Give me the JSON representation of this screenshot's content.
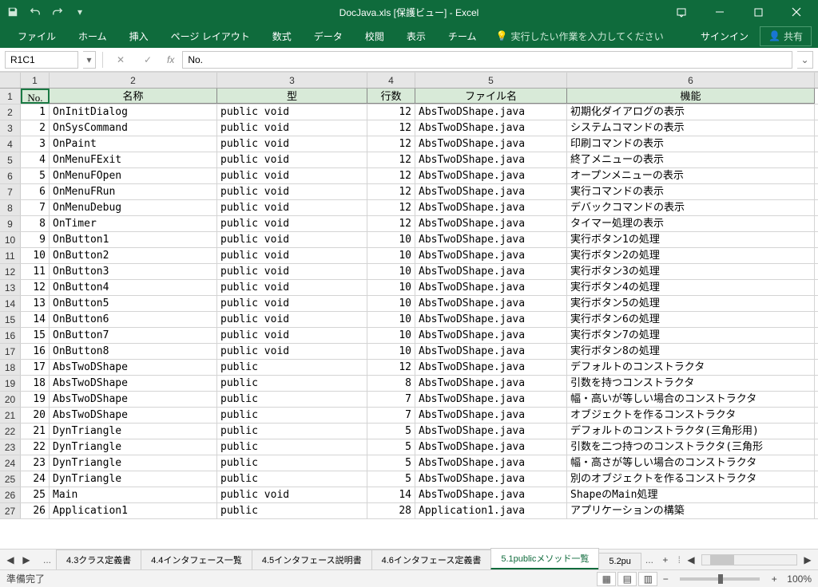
{
  "title": "DocJava.xls [保護ビュー] - Excel",
  "qat": {
    "save": "save",
    "undo": "undo",
    "redo": "redo"
  },
  "ribbon": {
    "tabs": [
      "ファイル",
      "ホーム",
      "挿入",
      "ページ レイアウト",
      "数式",
      "データ",
      "校閲",
      "表示",
      "チーム"
    ],
    "tell": "実行したい作業を入力してください",
    "signin": "サインイン",
    "share": "共有"
  },
  "namebox": "R1C1",
  "formula": "No.",
  "columns": [
    "1",
    "2",
    "3",
    "4",
    "5",
    "6"
  ],
  "headers": {
    "c1": "No.",
    "c2": "名称",
    "c3": "型",
    "c4": "行数",
    "c5": "ファイル名",
    "c6": "機能"
  },
  "rows": [
    {
      "n": 1,
      "name": "OnInitDialog",
      "type": "public void",
      "lines": 12,
      "file": "AbsTwoDShape.java",
      "func": "初期化ダイアログの表示"
    },
    {
      "n": 2,
      "name": "OnSysCommand",
      "type": "public void",
      "lines": 12,
      "file": "AbsTwoDShape.java",
      "func": "システムコマンドの表示"
    },
    {
      "n": 3,
      "name": "OnPaint",
      "type": "public void",
      "lines": 12,
      "file": "AbsTwoDShape.java",
      "func": "印刷コマンドの表示"
    },
    {
      "n": 4,
      "name": "OnMenuFExit",
      "type": "public void",
      "lines": 12,
      "file": "AbsTwoDShape.java",
      "func": "終了メニューの表示"
    },
    {
      "n": 5,
      "name": "OnMenuFOpen",
      "type": "public void",
      "lines": 12,
      "file": "AbsTwoDShape.java",
      "func": "オープンメニューの表示"
    },
    {
      "n": 6,
      "name": "OnMenuFRun",
      "type": "public void",
      "lines": 12,
      "file": "AbsTwoDShape.java",
      "func": "実行コマンドの表示"
    },
    {
      "n": 7,
      "name": "OnMenuDebug",
      "type": "public void",
      "lines": 12,
      "file": "AbsTwoDShape.java",
      "func": "デバックコマンドの表示"
    },
    {
      "n": 8,
      "name": "OnTimer",
      "type": "public void",
      "lines": 12,
      "file": "AbsTwoDShape.java",
      "func": "タイマー処理の表示"
    },
    {
      "n": 9,
      "name": "OnButton1",
      "type": "public void",
      "lines": 10,
      "file": "AbsTwoDShape.java",
      "func": "実行ボタン1の処理"
    },
    {
      "n": 10,
      "name": "OnButton2",
      "type": "public void",
      "lines": 10,
      "file": "AbsTwoDShape.java",
      "func": "実行ボタン2の処理"
    },
    {
      "n": 11,
      "name": "OnButton3",
      "type": "public void",
      "lines": 10,
      "file": "AbsTwoDShape.java",
      "func": "実行ボタン3の処理"
    },
    {
      "n": 12,
      "name": "OnButton4",
      "type": "public void",
      "lines": 10,
      "file": "AbsTwoDShape.java",
      "func": "実行ボタン4の処理"
    },
    {
      "n": 13,
      "name": "OnButton5",
      "type": "public void",
      "lines": 10,
      "file": "AbsTwoDShape.java",
      "func": "実行ボタン5の処理"
    },
    {
      "n": 14,
      "name": "OnButton6",
      "type": "public void",
      "lines": 10,
      "file": "AbsTwoDShape.java",
      "func": "実行ボタン6の処理"
    },
    {
      "n": 15,
      "name": "OnButton7",
      "type": "public void",
      "lines": 10,
      "file": "AbsTwoDShape.java",
      "func": "実行ボタン7の処理"
    },
    {
      "n": 16,
      "name": "OnButton8",
      "type": "public void",
      "lines": 10,
      "file": "AbsTwoDShape.java",
      "func": "実行ボタン8の処理"
    },
    {
      "n": 17,
      "name": "AbsTwoDShape",
      "type": "public",
      "lines": 12,
      "file": "AbsTwoDShape.java",
      "func": "デフォルトのコンストラクタ"
    },
    {
      "n": 18,
      "name": "AbsTwoDShape",
      "type": "public",
      "lines": 8,
      "file": "AbsTwoDShape.java",
      "func": "引数を持つコンストラクタ"
    },
    {
      "n": 19,
      "name": "AbsTwoDShape",
      "type": "public",
      "lines": 7,
      "file": "AbsTwoDShape.java",
      "func": "幅・高いが等しい場合のコンストラクタ"
    },
    {
      "n": 20,
      "name": "AbsTwoDShape",
      "type": "public",
      "lines": 7,
      "file": "AbsTwoDShape.java",
      "func": "オブジェクトを作るコンストラクタ"
    },
    {
      "n": 21,
      "name": "DynTriangle",
      "type": "public",
      "lines": 5,
      "file": "AbsTwoDShape.java",
      "func": "デフォルトのコンストラクタ(三角形用)"
    },
    {
      "n": 22,
      "name": "DynTriangle",
      "type": "public",
      "lines": 5,
      "file": "AbsTwoDShape.java",
      "func": "引数を二つ持つのコンストラクタ(三角形"
    },
    {
      "n": 23,
      "name": "DynTriangle",
      "type": "public",
      "lines": 5,
      "file": "AbsTwoDShape.java",
      "func": "幅・高さが等しい場合のコンストラクタ"
    },
    {
      "n": 24,
      "name": "DynTriangle",
      "type": "public",
      "lines": 5,
      "file": "AbsTwoDShape.java",
      "func": "別のオブジェクトを作るコンストラクタ"
    },
    {
      "n": 25,
      "name": "Main",
      "type": "public void",
      "lines": 14,
      "file": "AbsTwoDShape.java",
      "func": "ShapeのMain処理"
    },
    {
      "n": 26,
      "name": "Application1",
      "type": "public",
      "lines": 28,
      "file": "Application1.java",
      "func": "アプリケーションの構築"
    }
  ],
  "sheets": {
    "ellipsis": "...",
    "tabs": [
      "4.3クラス定義書",
      "4.4インタフェース一覧",
      "4.5インタフェース説明書",
      "4.6インタフェース定義書",
      "5.1publicメソッド一覧",
      "5.2pu"
    ],
    "more": "...",
    "active": 4,
    "add": "+"
  },
  "status": {
    "ready": "準備完了",
    "zoom": "100%"
  }
}
